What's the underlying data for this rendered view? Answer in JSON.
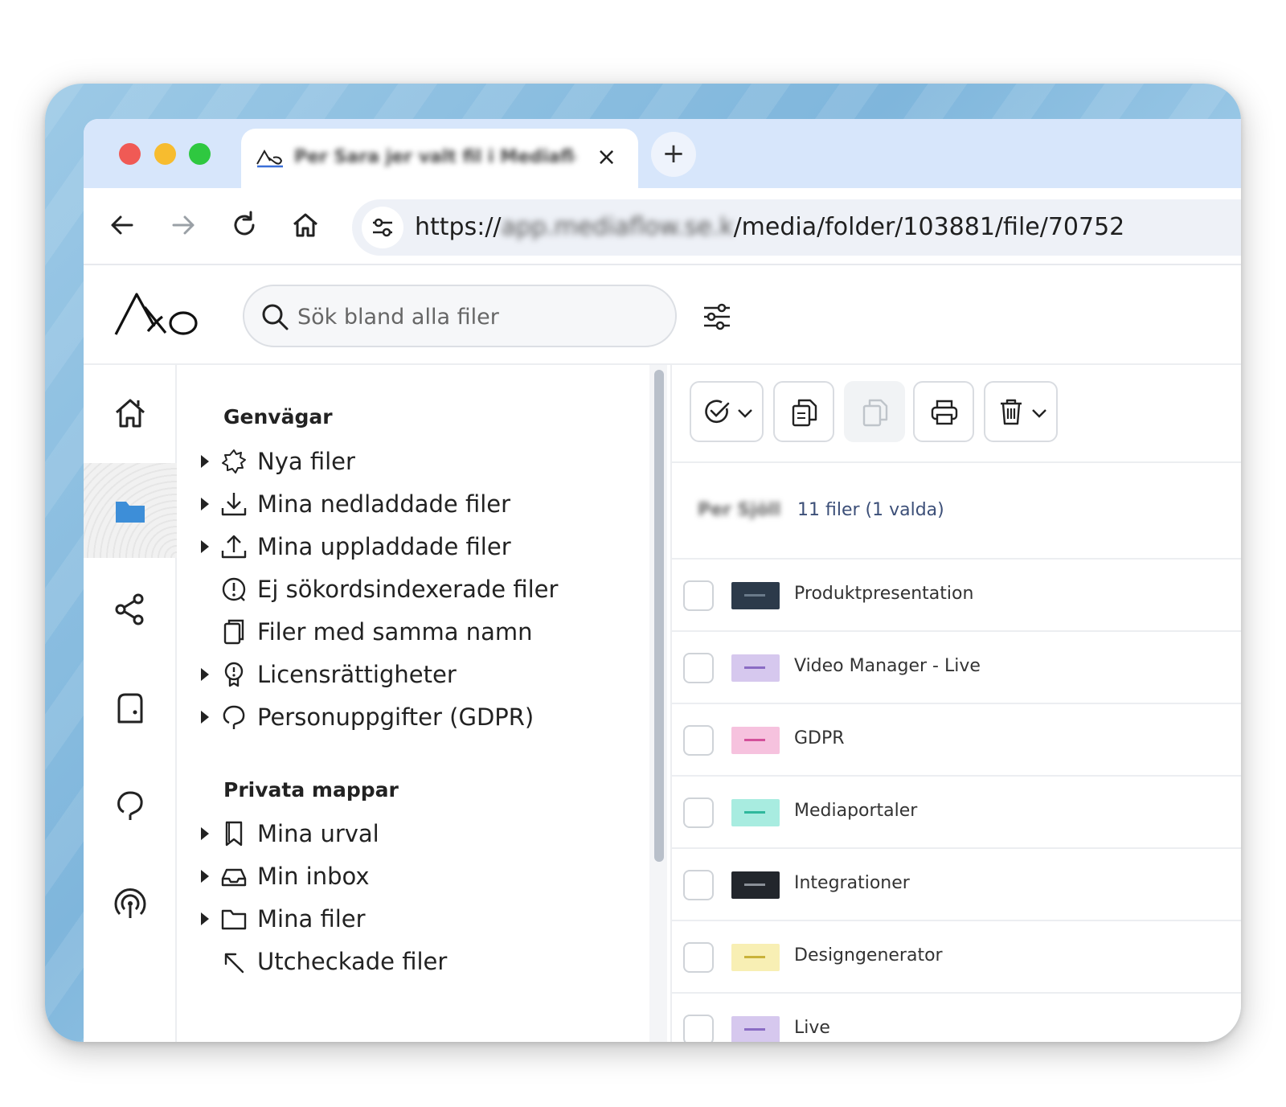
{
  "browser": {
    "tab_title": "Per Sara jer valt fil i Mediaflow",
    "new_tab_label": "+",
    "tab_close_label": "×",
    "url_prefix": "https://",
    "url_host": "app.mediaflow.se.k",
    "url_path": "/media/folder/103881/file/70752"
  },
  "header": {
    "search_placeholder": "Sök bland alla filer"
  },
  "rail": {
    "items": [
      "home-icon",
      "folder-icon",
      "share-icon",
      "document-icon",
      "location-icon",
      "broadcast-icon"
    ],
    "active": "folder-icon"
  },
  "tree": {
    "section_shortcuts": "Genvägar",
    "shortcuts": [
      {
        "label": "Nya filer",
        "icon": "sparkle-icon",
        "expandable": true
      },
      {
        "label": "Mina nedladdade filer",
        "icon": "download-icon",
        "expandable": true
      },
      {
        "label": "Mina uppladdade filer",
        "icon": "upload-icon",
        "expandable": true
      },
      {
        "label": "Ej sökordsindexerade filer",
        "icon": "alert-circle-icon",
        "expandable": false
      },
      {
        "label": "Filer med samma namn",
        "icon": "duplicate-icon",
        "expandable": false
      },
      {
        "label": "Licensrättigheter",
        "icon": "license-icon",
        "expandable": true
      },
      {
        "label": "Personuppgifter (GDPR)",
        "icon": "person-head-icon",
        "expandable": true
      }
    ],
    "section_private": "Privata mappar",
    "private": [
      {
        "label": "Mina urval",
        "icon": "bookmark-icon",
        "expandable": true
      },
      {
        "label": "Min inbox",
        "icon": "inbox-icon",
        "expandable": true
      },
      {
        "label": "Mina filer",
        "icon": "folder-outline-icon",
        "expandable": true
      },
      {
        "label": "Utcheckade filer",
        "icon": "arrow-up-left-icon",
        "expandable": false
      }
    ]
  },
  "files": {
    "summary_owner": "Per Sjöll",
    "summary_count": "11 filer (1 valda)",
    "rows": [
      {
        "name": "Produktpresentation",
        "thumb_color": "#2c3a4a",
        "dash_color": "#6a7a8a"
      },
      {
        "name": "Video Manager - Live",
        "thumb_color": "#d6c8ee",
        "dash_color": "#8a6cc4"
      },
      {
        "name": "GDPR",
        "thumb_color": "#f6c2de",
        "dash_color": "#d3509a"
      },
      {
        "name": "Mediaportaler",
        "thumb_color": "#a8ece0",
        "dash_color": "#2fb89c"
      },
      {
        "name": "Integrationer",
        "thumb_color": "#22262c",
        "dash_color": "#8a9098"
      },
      {
        "name": "Designgenerator",
        "thumb_color": "#f8efb4",
        "dash_color": "#c9b23a"
      },
      {
        "name": "Live",
        "thumb_color": "#d6c8ee",
        "dash_color": "#8a6cc4"
      }
    ]
  }
}
